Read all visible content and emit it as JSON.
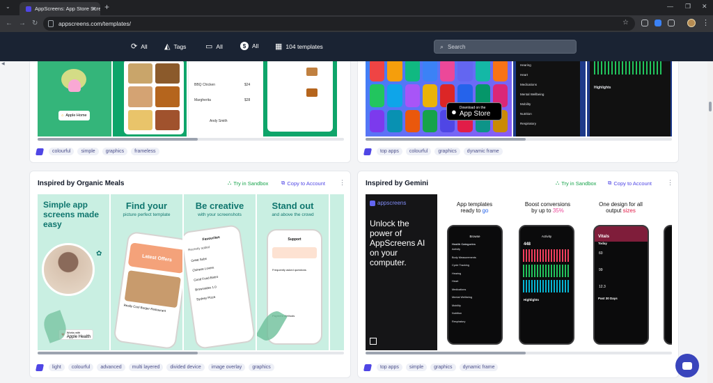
{
  "browser": {
    "tab_title": "AppScreens: App Store Screen...",
    "url": "appscreens.com/templates/"
  },
  "header": {
    "filters": [
      {
        "icon": "rotate-icon",
        "label": "All"
      },
      {
        "icon": "tags-icon",
        "label": "Tags"
      },
      {
        "icon": "devices-icon",
        "label": "All"
      },
      {
        "icon": "dollar-icon",
        "label": "All"
      },
      {
        "icon": "grid-icon",
        "label": "104 templates"
      }
    ],
    "search_placeholder": "Search"
  },
  "cards": [
    {
      "tags": [
        "colourful",
        "simple",
        "graphics",
        "frameless"
      ],
      "badge": "Apple Home",
      "food": [
        "BBQ Chicken",
        "Margherita",
        "Andy Smith"
      ],
      "prices": [
        "$24",
        "$28"
      ]
    },
    {
      "tags": [
        "top apps",
        "colourful",
        "graphics",
        "dynamic frame"
      ],
      "store_small": "Download on the",
      "store_big": "App Store",
      "health": [
        "Hearing",
        "Heart",
        "Medications",
        "Mental Wellbeing",
        "Mobility",
        "Nutrition",
        "Respiratory"
      ],
      "highlights": "Highlights"
    },
    {
      "title": "Inspired by Organic Meals",
      "try_label": "Try in Sandbox",
      "copy_label": "Copy to Account",
      "frames": [
        {
          "title": "Simple app screens made easy",
          "badge_small": "Works with",
          "badge": "Apple Health"
        },
        {
          "title": "Find your",
          "subtitle": "picture perfect template",
          "banner": "Latest Offers",
          "restaurant": "Really Cool Burger Restaurant"
        },
        {
          "title": "Be creative",
          "subtitle": "with your screenshots",
          "header": "Favourites",
          "items": [
            "Recently added",
            "Great Subs",
            "Chinese Lovers",
            "Good Food Bistro",
            "Brownsides 1.0",
            "Sydney Pizza"
          ]
        },
        {
          "title": "Stand out",
          "subtitle": "and above the crowd",
          "header": "Support",
          "faq": "Frequently asked questions",
          "methods": "Payment Methods"
        }
      ],
      "tags": [
        "light",
        "colourful",
        "advanced",
        "multi layered",
        "divided device",
        "image overlay",
        "graphics"
      ]
    },
    {
      "title": "Inspired by Gemini",
      "try_label": "Try in Sandbox",
      "copy_label": "Copy to Account",
      "frames": [
        {
          "logo": "appscreens",
          "text": "Unlock the power of AppScreens AI on your computer."
        },
        {
          "line1": "App templates",
          "line2": "ready to",
          "accent": "go",
          "accent_color": "#2563eb",
          "phone_title": "Browse",
          "phone_section": "Health Categories",
          "rows": [
            "Activity",
            "Body Measurements",
            "Cycle Tracking",
            "Hearing",
            "Heart",
            "Medications",
            "Mental Wellbeing",
            "Mobility",
            "Nutrition",
            "Respiratory"
          ]
        },
        {
          "line1": "Boost conversions",
          "line2": "by up to",
          "accent": "35%",
          "accent_color": "#ec4899",
          "phone_title": "Activity",
          "stat": "448",
          "section": "Highlights"
        },
        {
          "line1": "One design for all",
          "line2": "output",
          "accent": "sizes",
          "accent_color": "#e11d48",
          "phone_title": "Vitals",
          "section": "Today",
          "values": [
            "60",
            "99",
            "12.3"
          ],
          "past": "Past 30 Days"
        }
      ],
      "tags": [
        "top apps",
        "simple",
        "graphics",
        "dynamic frame"
      ]
    }
  ]
}
